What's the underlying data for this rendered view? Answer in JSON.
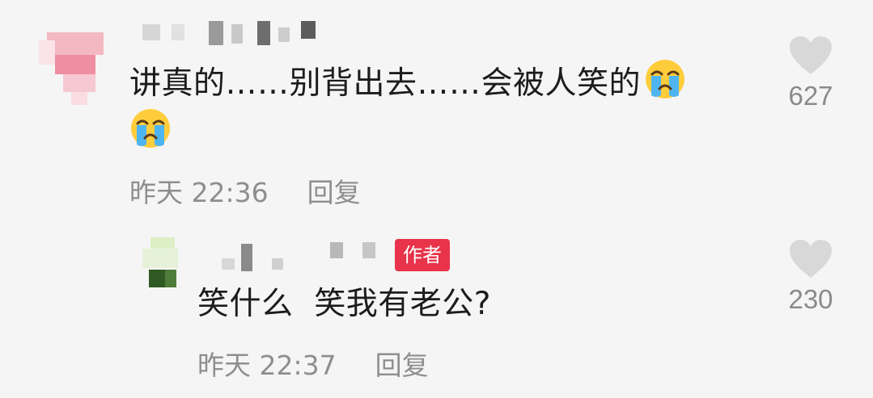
{
  "comments": [
    {
      "text": "讲真的……别背出去……会被人笑的",
      "time": "昨天 22:36",
      "reply_label": "回复",
      "likes": "627",
      "emojis": [
        "crying-face",
        "crying-face"
      ],
      "username_redacted": true
    },
    {
      "text": "笑什么  笑我有老公?",
      "time": "昨天 22:37",
      "reply_label": "回复",
      "likes": "230",
      "badge": "作者",
      "username_redacted": true
    }
  ],
  "colors": {
    "background": "#f5f5f5",
    "badge": "#e8334a",
    "meta_text": "#8e8e8e",
    "heart": "#d8d8d8"
  }
}
